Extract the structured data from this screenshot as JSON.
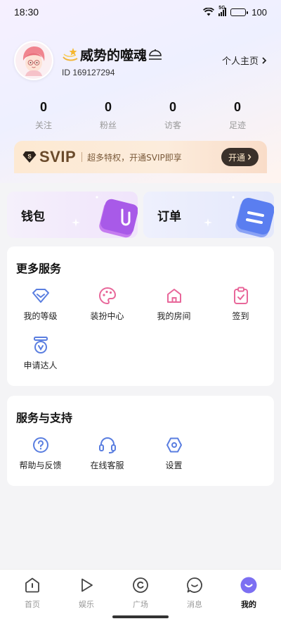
{
  "status_bar": {
    "time": "18:30",
    "signal_label": "5G",
    "battery": "100"
  },
  "profile": {
    "nickname": "威势的噬魂",
    "nickname_prefix_icon": "sparkle-star-icon",
    "nickname_suffix_icon": "umbrella-icon",
    "uid": "ID 169127294",
    "homepage_label": "个人主页"
  },
  "stats": [
    {
      "value": "0",
      "label": "关注"
    },
    {
      "value": "0",
      "label": "粉丝"
    },
    {
      "value": "0",
      "label": "访客"
    },
    {
      "value": "0",
      "label": "足迹"
    }
  ],
  "svip": {
    "badge": "SVIP",
    "description": "超多特权，开通SVIP即享",
    "button": "开通"
  },
  "quick_cards": [
    {
      "label": "钱包",
      "icon": "wallet-icon"
    },
    {
      "label": "订单",
      "icon": "order-icon"
    }
  ],
  "more_services": {
    "title": "更多服务",
    "items": [
      {
        "label": "我的等级",
        "icon": "level-icon"
      },
      {
        "label": "装扮中心",
        "icon": "palette-icon"
      },
      {
        "label": "我的房间",
        "icon": "house-icon"
      },
      {
        "label": "签到",
        "icon": "checkin-icon"
      },
      {
        "label": "申请达人",
        "icon": "expert-badge-icon"
      }
    ]
  },
  "support": {
    "title": "服务与支持",
    "items": [
      {
        "label": "帮助与反馈",
        "icon": "help-icon"
      },
      {
        "label": "在线客服",
        "icon": "headset-icon"
      },
      {
        "label": "设置",
        "icon": "settings-icon"
      }
    ]
  },
  "tabbar": {
    "active": "我的",
    "items": [
      {
        "label": "首页",
        "icon": "home-icon"
      },
      {
        "label": "娱乐",
        "icon": "play-icon"
      },
      {
        "label": "广场",
        "icon": "plaza-icon"
      },
      {
        "label": "消息",
        "icon": "message-icon"
      },
      {
        "label": "我的",
        "icon": "profile-icon"
      }
    ]
  },
  "colors": {
    "accent_purple": "#7c6ff2",
    "icon_blue": "#5a7ee0",
    "icon_pink": "#e8679a",
    "svip_text": "#6a4a2a",
    "svip_button_bg": "#3a302a"
  }
}
